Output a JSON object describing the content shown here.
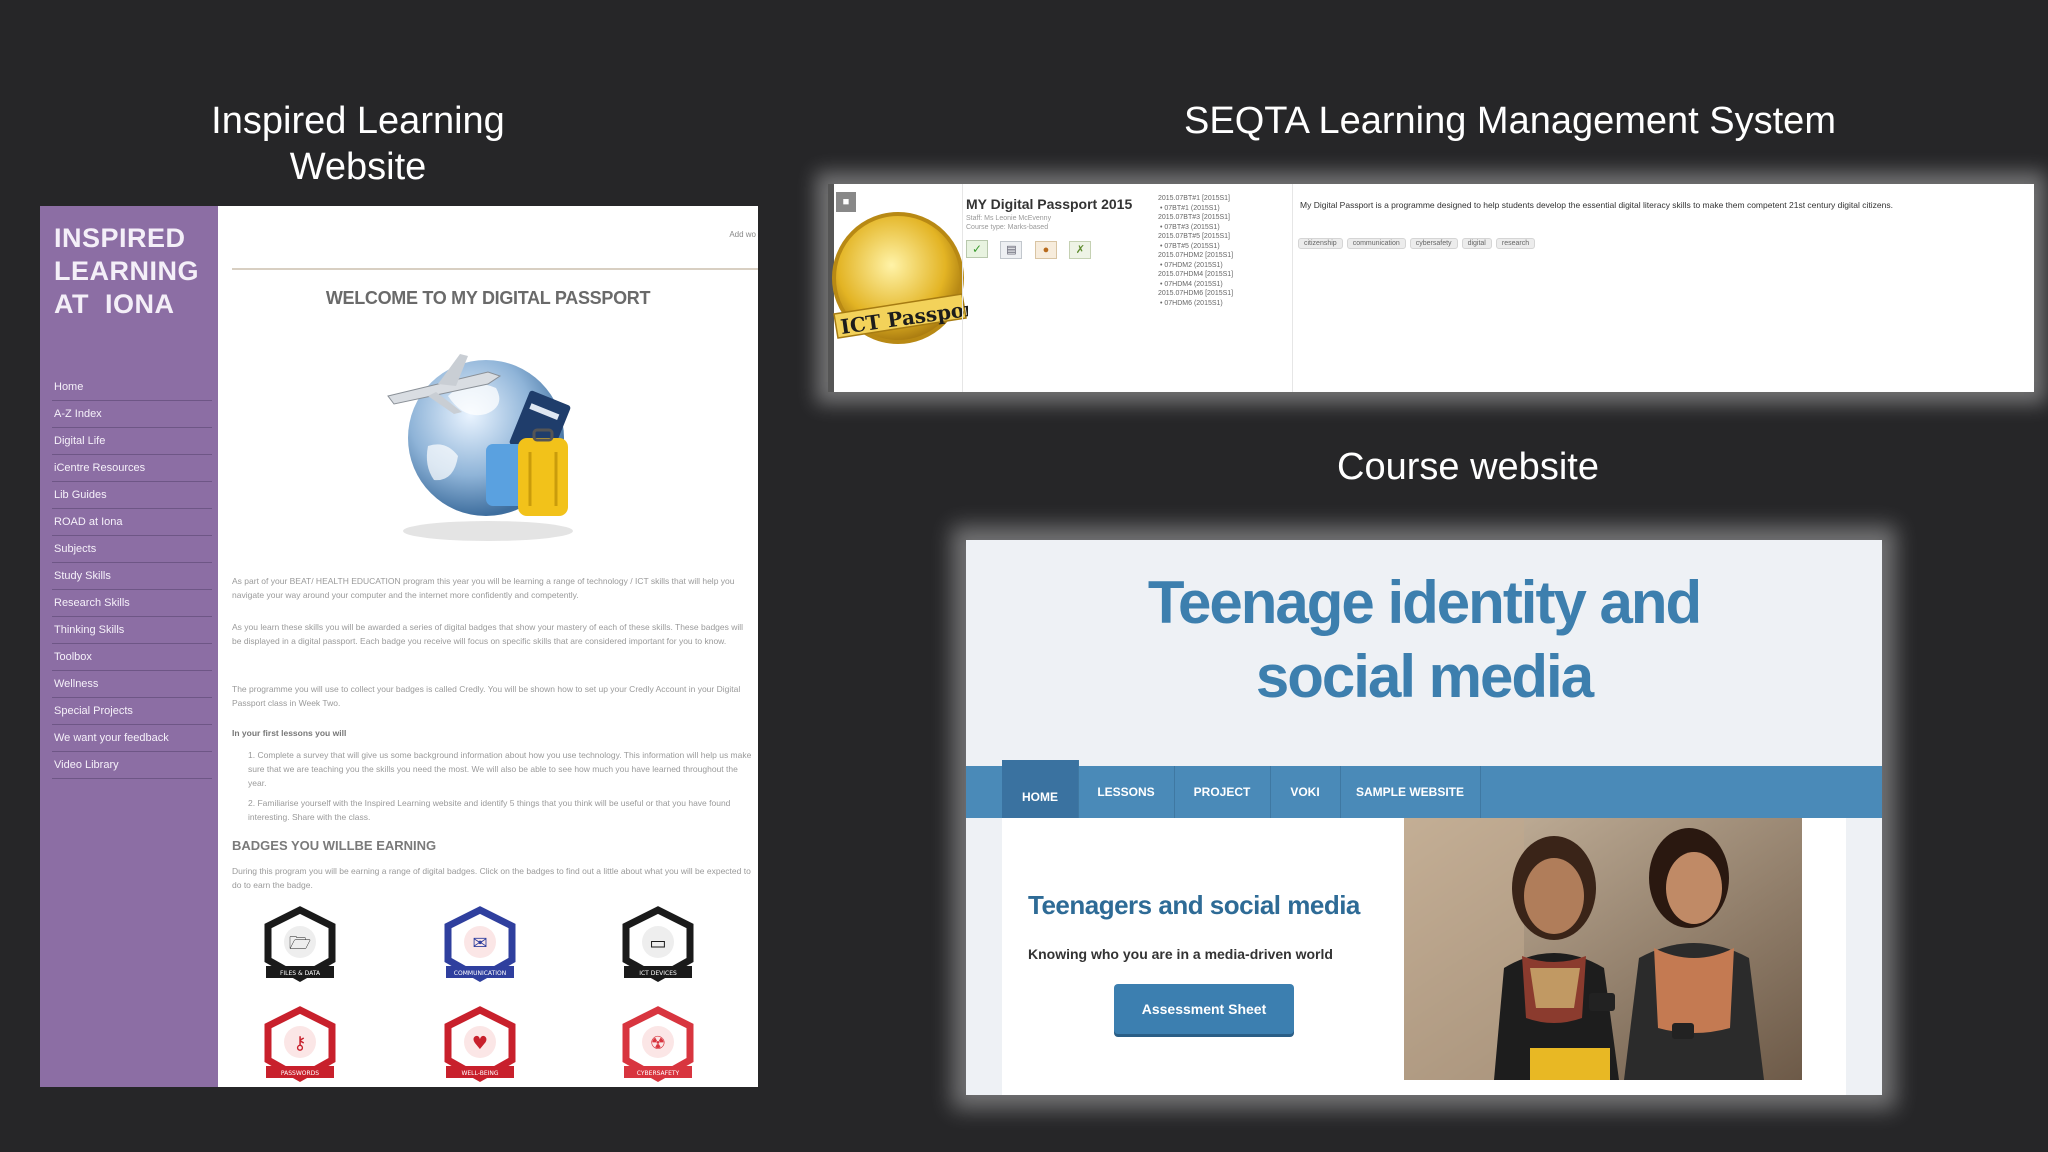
{
  "captions": {
    "inspired": "Inspired Learning\nWebsite",
    "seqta": "SEQTA Learning Management System",
    "course": "Course website"
  },
  "inspired_site": {
    "logo_line1": "INSPIRED",
    "logo_line2": "LEARNING",
    "logo_line3": "AT  IONA",
    "nav": [
      "Home",
      "A-Z Index",
      "Digital Life",
      "iCentre Resources",
      "Lib Guides",
      "ROAD at Iona",
      "Subjects",
      "Study Skills",
      "Research Skills",
      "Thinking Skills",
      "Toolbox",
      "Wellness",
      "Special Projects",
      "We want your feedback",
      "Video Library"
    ],
    "top_note": "Add wo",
    "page_title": "WELCOME TO MY DIGITAL PASSPORT",
    "para1": "As part of your BEAT/ HEALTH EDUCATION program this year you will be learning a range of technology / ICT skills that will help you navigate your way around your computer and the internet more confidently and competently.",
    "para2": "As you learn these skills you will be awarded a series of digital badges that show your mastery of each of these skills. These badges will be displayed in a digital passport. Each badge you receive will focus on specific skills that are considered important for you to know.",
    "para3": "The programme you will use to collect your badges is called Credly. You will be shown how to set up your Credly Account in your Digital Passport class in Week Two.",
    "lessons_heading": "In your first lessons you will",
    "item1": "1.  Complete a survey that will give us some background information about how you use technology. This information will help us make sure that we are teaching you the skills you need the most. We will also be able to see how much you have learned throughout the year.",
    "item2": "2.  Familiarise yourself with the Inspired Learning website and identify 5 things that you think will be useful or that you have found interesting. Share with the class.",
    "badges_heading": "BADGES YOU WILLBE EARNING",
    "badges_text": "During this program you will be earning a range of digital badges. Click on the badges to find out a little about what you will be expected to do to earn the badge.",
    "badges": [
      {
        "label": "FILES & DATA",
        "color": "#1a1a1a",
        "icon": "folder-icon"
      },
      {
        "label": "COMMUNICATION",
        "color": "#2f3f9e",
        "icon": "envelope-icon"
      },
      {
        "label": "ICT DEVICES",
        "color": "#1a1a1a",
        "icon": "monitor-icon"
      },
      {
        "label": "PASSWORDS",
        "color": "#c8202c",
        "icon": "key-icon"
      },
      {
        "label": "WELL-BEING",
        "color": "#c8202c",
        "icon": "hands-icon"
      },
      {
        "label": "CYBERSAFETY",
        "color": "#d8353f",
        "icon": "radiation-icon"
      }
    ]
  },
  "seqta": {
    "passport_label": "ICT Passport",
    "title": "MY Digital Passport 2015",
    "staff": "Staff: Ms Leonie McEvenny",
    "course_type": "Course type: Marks-based",
    "classes": [
      "2015.07BT#1 [2015S1]",
      "• 07BT#1 (2015S1)",
      "2015.07BT#3 [2015S1]",
      "• 07BT#3 (2015S1)",
      "2015.07BT#5 [2015S1]",
      "• 07BT#5 (2015S1)",
      "2015.07HDM2 [2015S1]",
      "• 07HDM2 (2015S1)",
      "2015.07HDM4 [2015S1]",
      "• 07HDM4 (2015S1)",
      "2015.07HDM6 [2015S1]",
      "• 07HDM6 (2015S1)"
    ],
    "description": "My Digital Passport is a programme designed to help students develop the essential digital literacy skills to make them competent 21st century digital citizens.",
    "tags": [
      "citizenship",
      "communication",
      "cybersafety",
      "digital",
      "research"
    ]
  },
  "course_site": {
    "title_line1": "Teenage identity and",
    "title_line2": "social media",
    "nav": [
      "HOME",
      "LESSONS",
      "PROJECT",
      "VOKI",
      "SAMPLE WEBSITE"
    ],
    "heading": "Teenagers and social media",
    "tagline": "Knowing who you are in a media-driven world",
    "button": "Assessment Sheet"
  }
}
